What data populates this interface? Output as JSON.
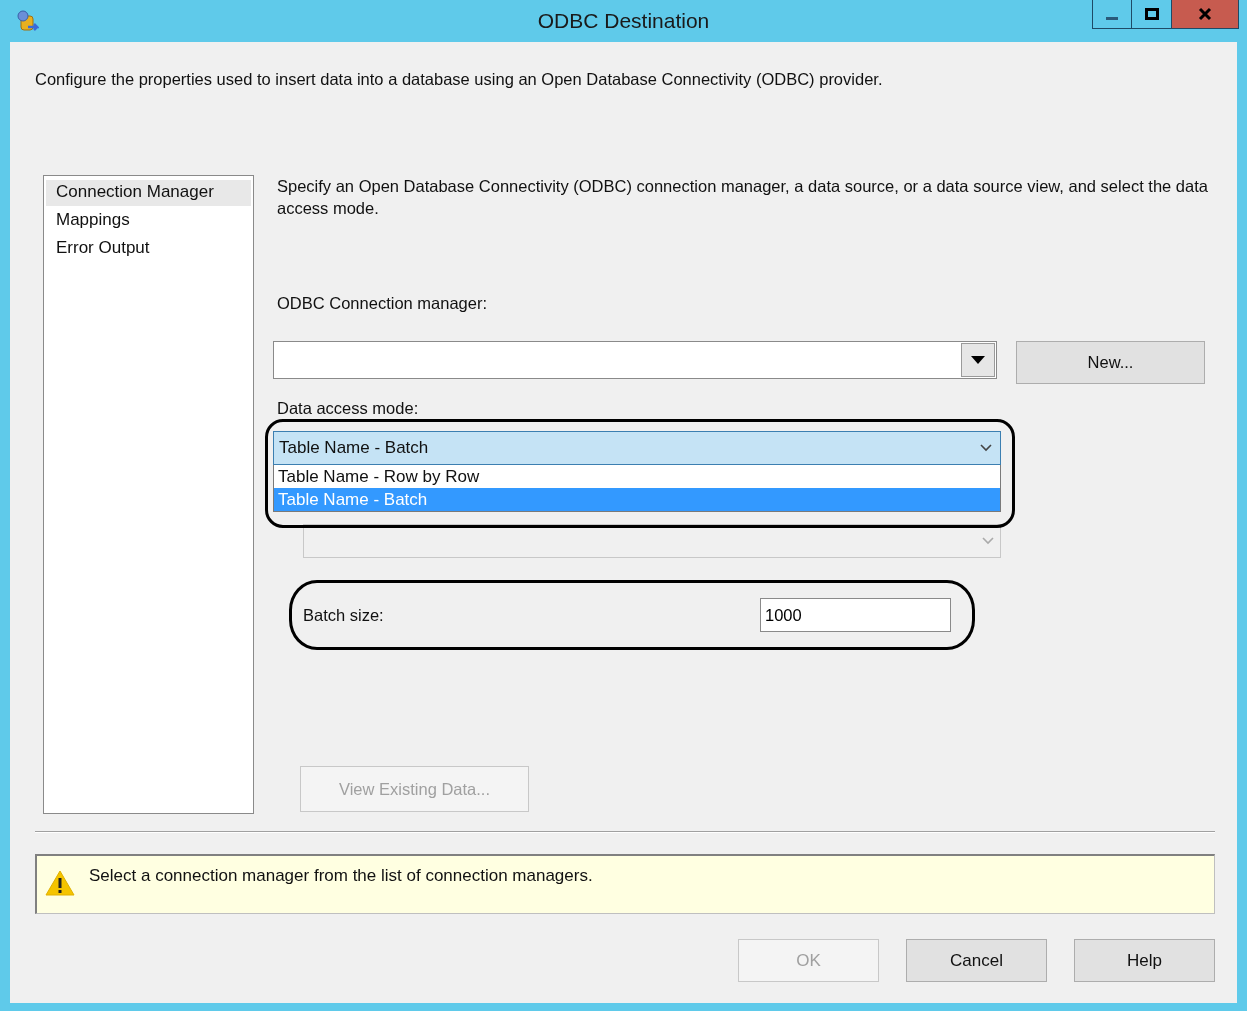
{
  "window": {
    "title": "ODBC Destination"
  },
  "description": "Configure the properties used to insert data into a database using an Open Database Connectivity (ODBC) provider.",
  "sidebar": {
    "items": [
      {
        "label": "Connection Manager",
        "selected": true
      },
      {
        "label": "Mappings",
        "selected": false
      },
      {
        "label": "Error Output",
        "selected": false
      }
    ]
  },
  "panel": {
    "description": "Specify an Open Database Connectivity (ODBC) connection manager, a data source, or a data source view, and select the data access mode.",
    "connection_label": "ODBC Connection manager:",
    "new_button": "New...",
    "access_mode_label": "Data access mode:",
    "access_mode": {
      "value": "Table Name - Batch",
      "expanded": true,
      "options": [
        {
          "label": "Table Name - Row by Row",
          "selected": false
        },
        {
          "label": "Table Name - Batch",
          "selected": true
        }
      ]
    },
    "table_combo": {
      "disabled": true
    },
    "batch_size_label": "Batch size:",
    "batch_size": "1000",
    "view_button": {
      "label": "View Existing Data...",
      "disabled": true
    }
  },
  "warning": "Select a connection manager from the list of connection managers.",
  "buttons": [
    {
      "label": "OK",
      "disabled": true
    },
    {
      "label": "Cancel",
      "disabled": false
    },
    {
      "label": "Help",
      "disabled": false
    }
  ]
}
